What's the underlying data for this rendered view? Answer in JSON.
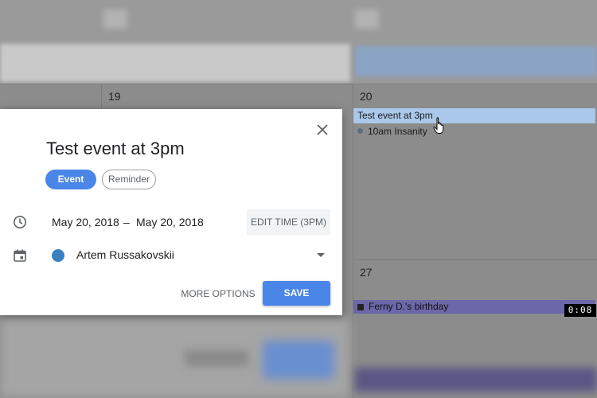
{
  "calendar": {
    "day_19": "19",
    "day_20": "20",
    "day_27": "27",
    "events": {
      "test_event": "Test event at 3pm",
      "insanity_time": "10am",
      "insanity_title": "Insanity",
      "birthday": "Ferny D.'s birthday"
    }
  },
  "video_timer": "0:08",
  "dialog": {
    "title": "Test event at 3pm",
    "chips": {
      "event": "Event",
      "reminder": "Reminder"
    },
    "start_date": "May 20, 2018",
    "dash": "–",
    "end_date": "May 20, 2018",
    "edit_time": "EDIT TIME (3PM)",
    "calendar_owner": "Artem Russakovskii",
    "calendar_color": "#3a80c0",
    "more_options": "MORE OPTIONS",
    "save": "SAVE"
  },
  "icons": [
    "close-icon",
    "clock-icon",
    "calendar-icon",
    "dropdown-arrow-icon",
    "cake-icon",
    "hand-cursor-icon"
  ],
  "colors": {
    "accent": "#4a86e8",
    "event_blue": "#a9c8ea",
    "birthday_purple": "#6b67a8"
  }
}
